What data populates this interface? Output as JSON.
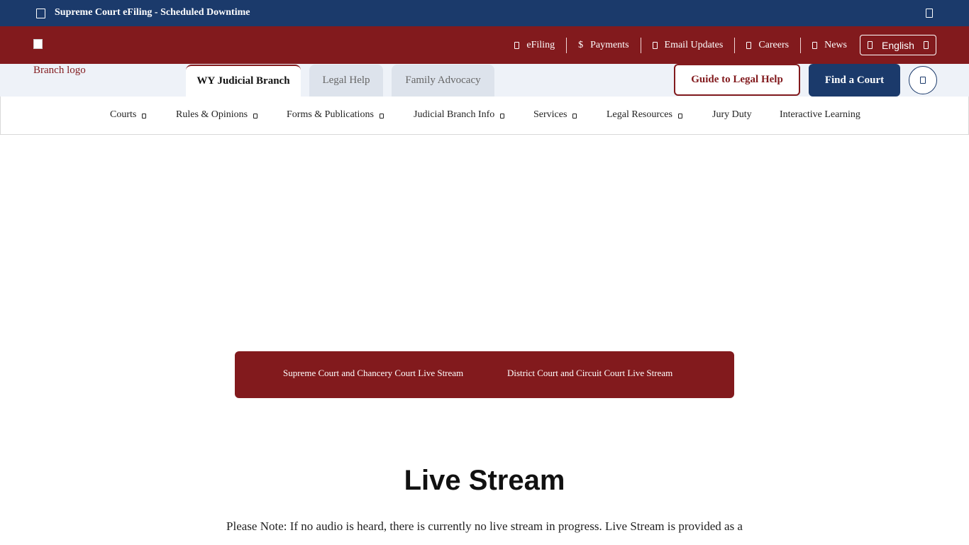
{
  "alert": {
    "text": "Supreme Court eFiling - Scheduled Downtime",
    "check_icon": "checkbox-icon",
    "close_icon": "close-icon"
  },
  "utility_nav": {
    "links": [
      {
        "label": "eFiling",
        "icon": "file-icon"
      },
      {
        "label": "Payments",
        "icon": "dollar-icon"
      },
      {
        "label": "Email Updates",
        "icon": "envelope-icon"
      },
      {
        "label": "Careers",
        "icon": "briefcase-icon"
      },
      {
        "label": "News",
        "icon": "newspaper-icon"
      }
    ],
    "payments_glyph": "$",
    "language": {
      "label": "English",
      "icon": "globe-icon",
      "caret_icon": "chevron-down-icon"
    }
  },
  "logo": {
    "alt_text": "Branch logo"
  },
  "site_tabs": [
    {
      "label": "WY Judicial Branch",
      "active": true
    },
    {
      "label": "Legal Help",
      "active": false
    },
    {
      "label": "Family Advocacy",
      "active": false
    }
  ],
  "header_buttons": {
    "guide": "Guide to Legal Help",
    "find": "Find a Court",
    "search_icon": "search-icon"
  },
  "main_nav": [
    {
      "label": "Courts",
      "has_dropdown": true
    },
    {
      "label": "Rules & Opinions",
      "has_dropdown": true
    },
    {
      "label": "Forms & Publications",
      "has_dropdown": true
    },
    {
      "label": "Judicial Branch Info",
      "has_dropdown": true
    },
    {
      "label": "Services",
      "has_dropdown": true
    },
    {
      "label": "Legal Resources",
      "has_dropdown": true
    },
    {
      "label": "Jury Duty",
      "has_dropdown": false
    },
    {
      "label": "Interactive Learning",
      "has_dropdown": false
    }
  ],
  "stream_links": [
    "Supreme Court and Chancery Court Live Stream",
    "District Court and Circuit Court Live Stream"
  ],
  "content": {
    "title": "Live Stream",
    "note": "Please Note: If no audio is heard, there is currently no live stream in progress. Live Stream is provided as a"
  },
  "colors": {
    "navy": "#1b3a6b",
    "maroon": "#821a1d",
    "site_bar_bg": "#eef2f8"
  }
}
